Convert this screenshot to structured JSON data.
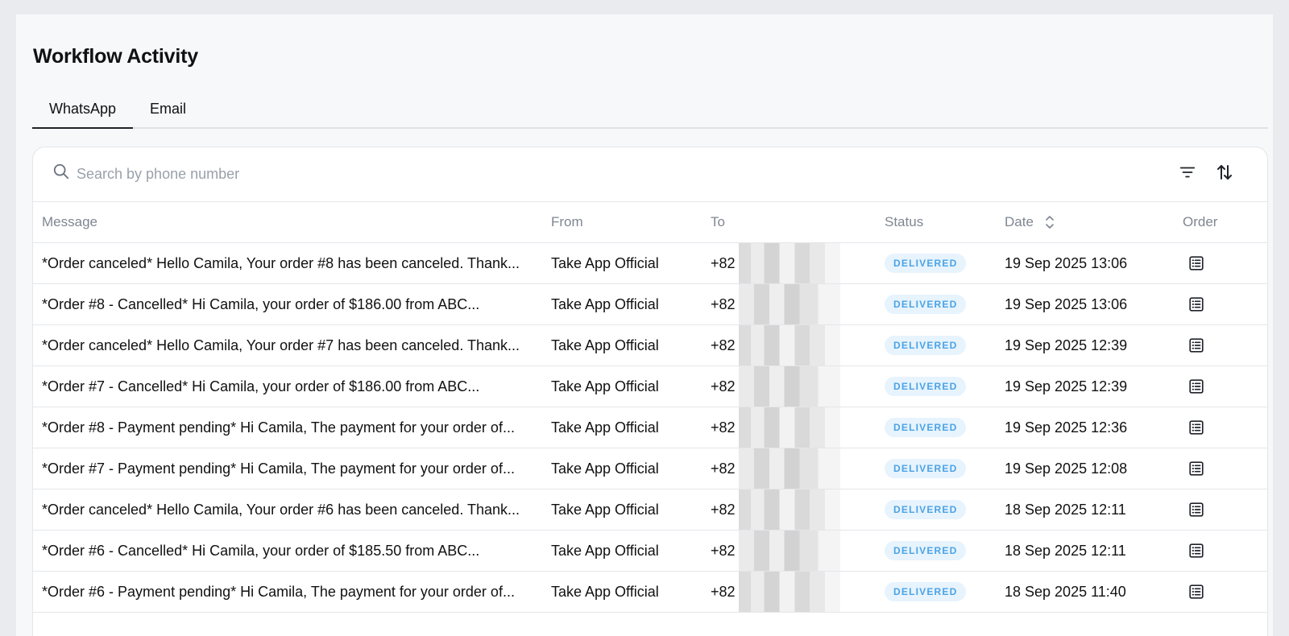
{
  "page": {
    "title": "Workflow Activity"
  },
  "tabs": [
    {
      "label": "WhatsApp",
      "active": true
    },
    {
      "label": "Email",
      "active": false
    }
  ],
  "search": {
    "placeholder": "Search by phone number",
    "value": ""
  },
  "toolbar": {
    "filter_icon": "filter-icon",
    "sort_icon": "sort-arrows-icon"
  },
  "table": {
    "columns": {
      "message": "Message",
      "from": "From",
      "to": "To",
      "status": "Status",
      "date": "Date",
      "order": "Order"
    },
    "rows": [
      {
        "message": "*Order canceled* Hello Camila, Your order #8 has been canceled. Thank...",
        "from": "Take App Official",
        "to": "+82",
        "status": "DELIVERED",
        "date": "19 Sep 2025 13:06"
      },
      {
        "message": "*Order #8 - Cancelled* Hi Camila, your order of $186.00 from ABC...",
        "from": "Take App Official",
        "to": "+82",
        "status": "DELIVERED",
        "date": "19 Sep 2025 13:06"
      },
      {
        "message": "*Order canceled* Hello Camila, Your order #7 has been canceled. Thank...",
        "from": "Take App Official",
        "to": "+82",
        "status": "DELIVERED",
        "date": "19 Sep 2025 12:39"
      },
      {
        "message": "*Order #7 - Cancelled* Hi Camila, your order of $186.00 from ABC...",
        "from": "Take App Official",
        "to": "+82",
        "status": "DELIVERED",
        "date": "19 Sep 2025 12:39"
      },
      {
        "message": "*Order #8 - Payment pending* Hi Camila, The payment for your order of...",
        "from": "Take App Official",
        "to": "+82",
        "status": "DELIVERED",
        "date": "19 Sep 2025 12:36"
      },
      {
        "message": "*Order #7 - Payment pending* Hi Camila, The payment for your order of...",
        "from": "Take App Official",
        "to": "+82",
        "status": "DELIVERED",
        "date": "19 Sep 2025 12:08"
      },
      {
        "message": "*Order canceled* Hello Camila, Your order #6 has been canceled. Thank...",
        "from": "Take App Official",
        "to": "+82",
        "status": "DELIVERED",
        "date": "18 Sep 2025 12:11"
      },
      {
        "message": "*Order #6 - Cancelled* Hi Camila, your order of $185.50 from ABC...",
        "from": "Take App Official",
        "to": "+82",
        "status": "DELIVERED",
        "date": "18 Sep 2025 12:11"
      },
      {
        "message": "*Order #6 - Payment pending* Hi Camila, The payment for your order of...",
        "from": "Take App Official",
        "to": "+82",
        "status": "DELIVERED",
        "date": "18 Sep 2025 11:40"
      }
    ]
  },
  "colors": {
    "badge_bg": "#e7f3fd",
    "badge_text": "#4aa3e6",
    "active_tab": "#1f2329"
  }
}
